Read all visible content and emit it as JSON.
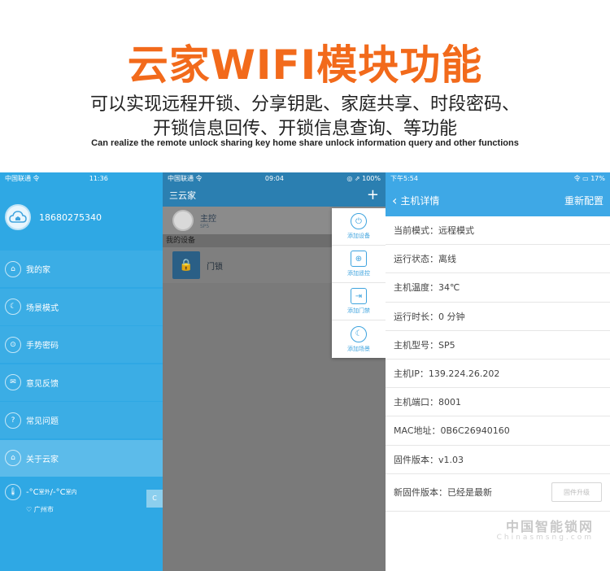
{
  "header": {
    "title": "云家WIFI模块功能",
    "subtitle_line1": "可以实现远程开锁、分享钥匙、家庭共享、时段密码、",
    "subtitle_line2": "开锁信息回传、开锁信息查询、等功能",
    "english": "Can realize the remote unlock sharing key home share unlock information query and other functions"
  },
  "screen1": {
    "status": {
      "carrier": "中国联通 令",
      "time": "11:36",
      "right": ""
    },
    "phone": "18680275340",
    "menu": [
      {
        "label": "我的家",
        "icon": "⌂"
      },
      {
        "label": "场景模式",
        "icon": "☾"
      },
      {
        "label": "手势密码",
        "icon": "⊙"
      },
      {
        "label": "意见反馈",
        "icon": "✉"
      },
      {
        "label": "常见问题",
        "icon": "?"
      },
      {
        "label": "关于云家",
        "icon": "⌂"
      }
    ],
    "weather": {
      "temp_out": "-°C",
      "out_label": "室外",
      "sep": "/",
      "temp_in": "-°C",
      "in_label": "室内",
      "city": "广州市"
    },
    "corner": "C"
  },
  "screen2": {
    "status": {
      "carrier": "中国联通 令",
      "time": "09:04",
      "right": "◎ ⇗ 100%"
    },
    "nav_title": "三云家",
    "plus": "+",
    "hub": {
      "name": "主控",
      "model": "SP5"
    },
    "section": "我的设备",
    "device": {
      "name": "门锁"
    },
    "add_menu": [
      {
        "label": "添加设备",
        "icon": "⏻"
      },
      {
        "label": "添加遥控",
        "icon": "⊕"
      },
      {
        "label": "添加门禁",
        "icon": "⇥"
      },
      {
        "label": "添加场景",
        "icon": "☾"
      }
    ]
  },
  "screen3": {
    "status": {
      "left": "下午5:54",
      "right": "令 ▭ 17%"
    },
    "nav_title": "主机详情",
    "nav_action": "重新配置",
    "rows": [
      "当前模式：远程模式",
      "运行状态：离线",
      "主机温度：34℃",
      "运行时长：0 分钟",
      "主机型号：SP5",
      "主机IP：139.224.26.202",
      "主机端口：8001",
      "MAC地址：0B6C26940160",
      "固件版本：v1.03"
    ],
    "new_fw": "新固件版本：已经是最新",
    "fw_button": "固件升级"
  },
  "watermark": {
    "text": "中国智能锁网",
    "url": "Chinasmsng.com"
  }
}
